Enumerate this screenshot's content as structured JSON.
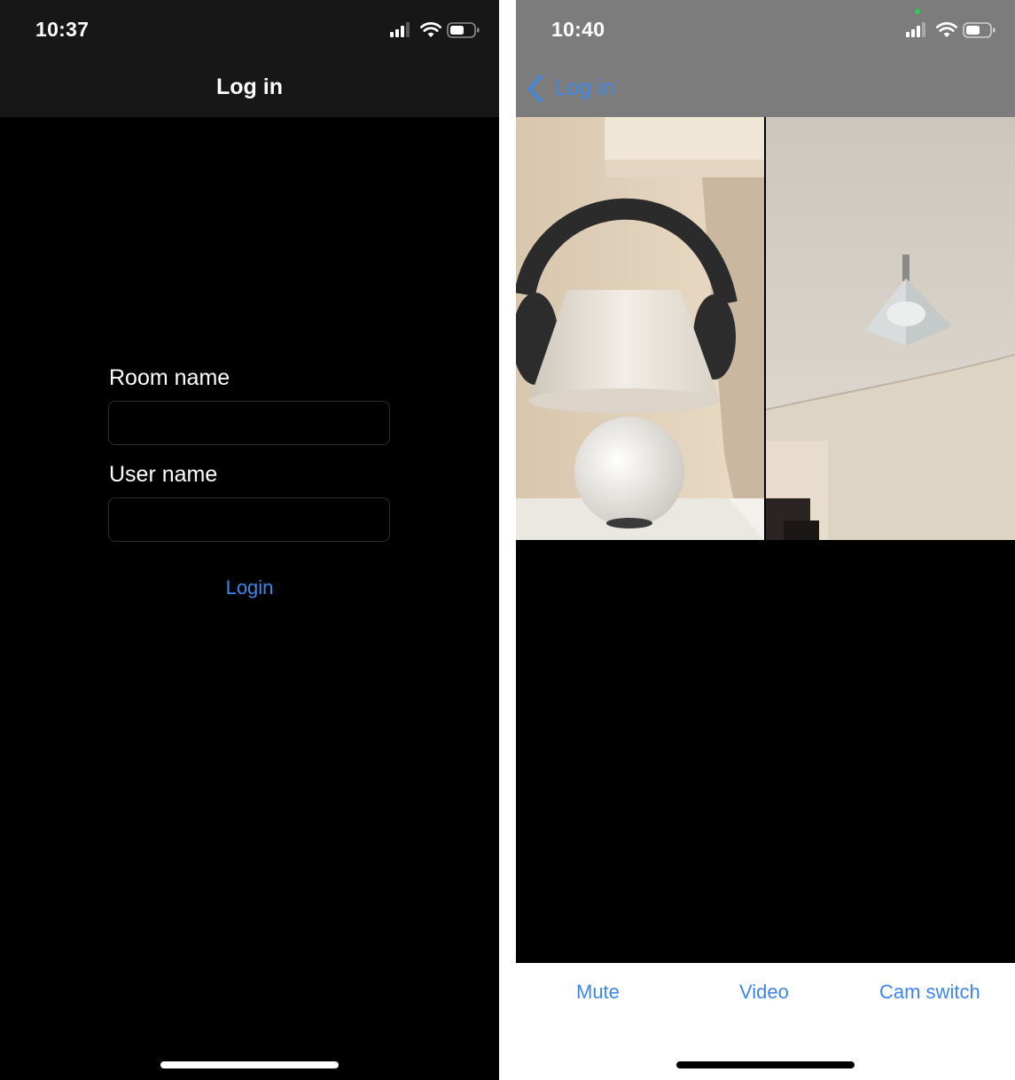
{
  "left_screen": {
    "status": {
      "time": "10:37"
    },
    "navbar": {
      "title": "Log in"
    },
    "form": {
      "room_label": "Room name",
      "room_value": "",
      "user_label": "User name",
      "user_value": "",
      "login_label": "Login"
    }
  },
  "right_screen": {
    "status": {
      "time": "10:40"
    },
    "navbar": {
      "back_label": "Log in"
    },
    "controls": {
      "mute_label": "Mute",
      "video_label": "Video",
      "cam_switch_label": "Cam switch"
    }
  },
  "colors": {
    "accent": "#3d86e8",
    "dark_bar": "#171717",
    "right_header": "#7c7c7c",
    "camera_indicator": "#34c759"
  },
  "icons": [
    "cellular-signal-icon",
    "wifi-icon",
    "battery-icon",
    "chevron-left-icon",
    "camera-in-use-icon"
  ]
}
